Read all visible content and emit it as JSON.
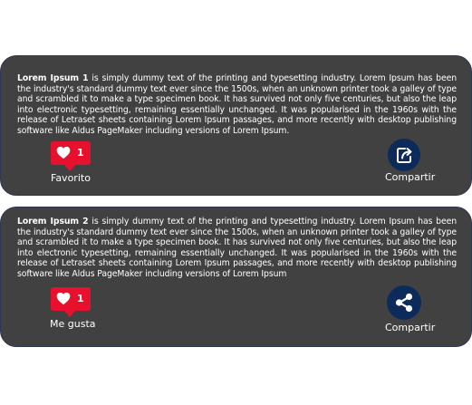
{
  "cards": [
    {
      "title_bold": "Lorem Ipsum 1",
      "body": " is simply dummy text of the printing and typesetting industry. Lorem Ipsum has been the industry's standard dummy text ever since the 1500s, when an unknown printer took a galley of type and scrambled it to make a type specimen book. It has survived not only five centuries, but also the leap into electronic typesetting, remaining essentially unchanged. It was popularised in the 1960s with the release of Letraset sheets containing Lorem Ipsum passages, and more recently with desktop publishing software like Aldus PageMaker including versions of Lorem Ipsum.",
      "like_count": "1",
      "like_label": "Favorito",
      "share_label": "Compartir",
      "share_icon": "share-external-icon"
    },
    {
      "title_bold": "Lorem Ipsum 2",
      "body": " is simply dummy text of the printing and typesetting industry. Lorem Ipsum has been the industry's standard dummy text ever since the 1500s, when an unknown printer took a galley of type and scrambled it to make a type specimen book. It has survived not only five centuries, but also the leap into electronic typesetting, remaining essentially unchanged. It was popularised in the 1960s with the release of Letraset sheets containing Lorem Ipsum passages, and more recently with desktop publishing software like Aldus PageMaker including versions of Lorem Ipsum",
      "like_count": "1",
      "like_label": "Me gusta",
      "share_label": "Compartir",
      "share_icon": "share-nodes-icon"
    }
  ],
  "colors": {
    "card_background": "#414141",
    "like_badge": "#e8112d",
    "share_circle": "#0c2a5a",
    "text": "#ffffff"
  }
}
